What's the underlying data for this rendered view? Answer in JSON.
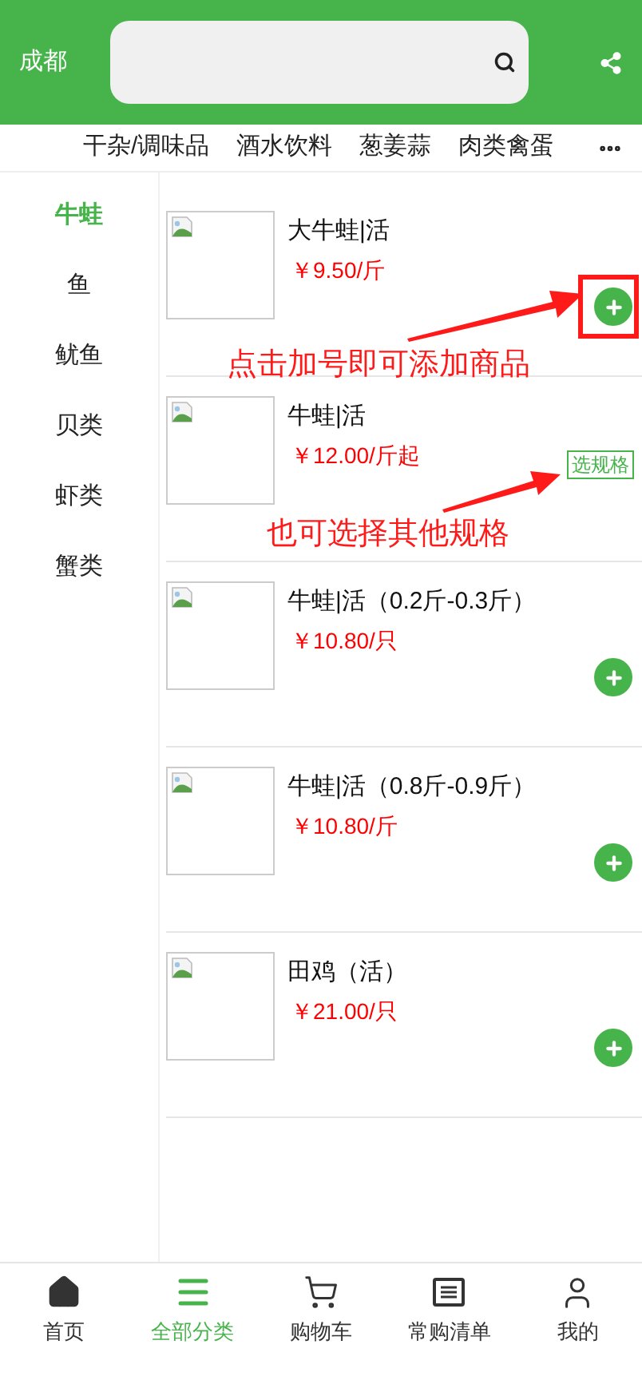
{
  "header": {
    "city": "成都"
  },
  "tabs": [
    {
      "label": "干杂/调味品",
      "selected": false
    },
    {
      "label": "酒水饮料",
      "selected": false
    },
    {
      "label": "葱姜蒜",
      "selected": false
    },
    {
      "label": "肉类禽蛋",
      "selected": false
    }
  ],
  "sidebar": {
    "items": [
      {
        "label": "牛蛙",
        "selected": true
      },
      {
        "label": "鱼",
        "selected": false
      },
      {
        "label": "鱿鱼",
        "selected": false
      },
      {
        "label": "贝类",
        "selected": false
      },
      {
        "label": "虾类",
        "selected": false
      },
      {
        "label": "蟹类",
        "selected": false
      }
    ]
  },
  "products": [
    {
      "name": "大牛蛙|活",
      "price": "￥9.50/斤",
      "kind": "add",
      "highlighted": true
    },
    {
      "name": "牛蛙|活",
      "price": "￥12.00/斤起",
      "kind": "spec",
      "button": "选规格",
      "highlighted": false
    },
    {
      "name": "牛蛙|活（0.2斤-0.3斤）",
      "price": "￥10.80/只",
      "kind": "add",
      "highlighted": false
    },
    {
      "name": "牛蛙|活（0.8斤-0.9斤）",
      "price": "￥10.80/斤",
      "kind": "add",
      "highlighted": false
    },
    {
      "name": "田鸡（活）",
      "price": "￥21.00/只",
      "kind": "add",
      "highlighted": false
    }
  ],
  "annotations": [
    {
      "text": "点击加号即可添加商品"
    },
    {
      "text": "也可选择其他规格"
    }
  ],
  "bottom_nav": [
    {
      "label": "首页",
      "kind": "home",
      "selected": false
    },
    {
      "label": "全部分类",
      "kind": "category",
      "selected": true
    },
    {
      "label": "购物车",
      "kind": "cart",
      "selected": false
    },
    {
      "label": "常购清单",
      "kind": "list",
      "selected": false
    },
    {
      "label": "我的",
      "kind": "user",
      "selected": false
    }
  ]
}
